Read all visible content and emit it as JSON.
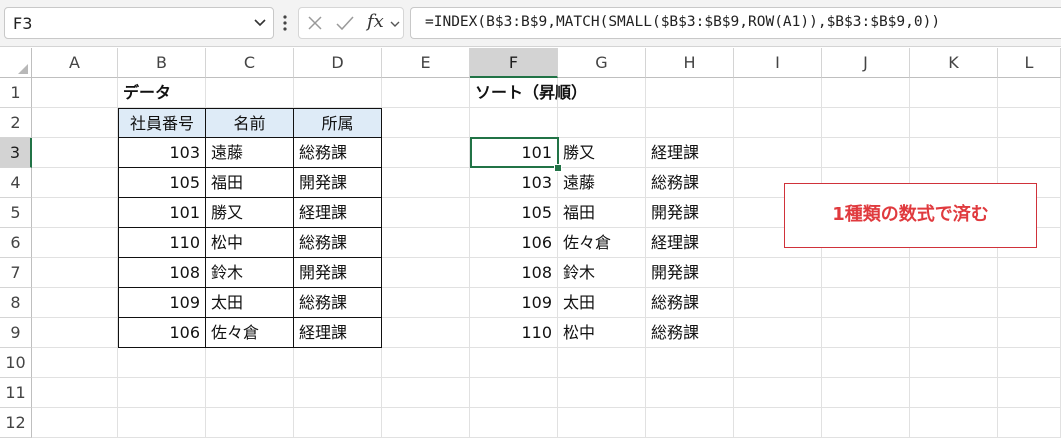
{
  "formula_bar": {
    "name_box": "F3",
    "formula": "=INDEX(B$3:B$9,MATCH(SMALL($B$3:$B$9,ROW(A1)),$B$3:$B$9,0))",
    "fx_label": "fx",
    "icons": [
      "chevron-down-icon",
      "more-icon",
      "cancel-icon",
      "enter-icon",
      "function-icon"
    ]
  },
  "columns": [
    "A",
    "B",
    "C",
    "D",
    "E",
    "F",
    "G",
    "H",
    "I",
    "J",
    "K",
    "L"
  ],
  "rows": [
    "1",
    "2",
    "3",
    "4",
    "5",
    "6",
    "7",
    "8",
    "9",
    "10",
    "11",
    "12"
  ],
  "selected_cell": "F3",
  "data_title": "データ",
  "table_headers": [
    "社員番号",
    "名前",
    "所属"
  ],
  "table_rows": [
    {
      "id": "103",
      "name": "遠藤",
      "dept": "総務課"
    },
    {
      "id": "105",
      "name": "福田",
      "dept": "開発課"
    },
    {
      "id": "101",
      "name": "勝又",
      "dept": "経理課"
    },
    {
      "id": "110",
      "name": "松中",
      "dept": "総務課"
    },
    {
      "id": "108",
      "name": "鈴木",
      "dept": "開発課"
    },
    {
      "id": "109",
      "name": "太田",
      "dept": "総務課"
    },
    {
      "id": "106",
      "name": "佐々倉",
      "dept": "経理課"
    }
  ],
  "sort_title": "ソート（昇順）",
  "sorted_rows": [
    {
      "id": "101",
      "name": "勝又",
      "dept": "経理課"
    },
    {
      "id": "103",
      "name": "遠藤",
      "dept": "総務課"
    },
    {
      "id": "105",
      "name": "福田",
      "dept": "開発課"
    },
    {
      "id": "106",
      "name": "佐々倉",
      "dept": "経理課"
    },
    {
      "id": "108",
      "name": "鈴木",
      "dept": "開発課"
    },
    {
      "id": "109",
      "name": "太田",
      "dept": "総務課"
    },
    {
      "id": "110",
      "name": "松中",
      "dept": "総務課"
    }
  ],
  "note": "1種類の数式で済む",
  "colors": {
    "accent": "#217346",
    "header_fill": "#deebf7",
    "note_red": "#e03a3e"
  }
}
